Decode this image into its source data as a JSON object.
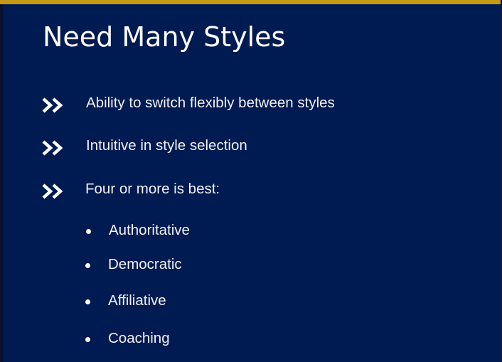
{
  "slide": {
    "title": "Need Many Styles",
    "bullets": [
      {
        "text": "Ability to switch flexibly between styles",
        "icon": "double-chevron-right-icon"
      },
      {
        "text": "Intuitive in style selection",
        "icon": "double-chevron-right-icon"
      },
      {
        "text": "Four or more is best:",
        "icon": "double-chevron-right-icon"
      }
    ],
    "sub_bullets": [
      {
        "text": "Authoritative",
        "icon": "bullet-dot-icon"
      },
      {
        "text": "Democratic",
        "icon": "bullet-dot-icon"
      },
      {
        "text": "Affiliative",
        "icon": "bullet-dot-icon"
      },
      {
        "text": "Coaching",
        "icon": "bullet-dot-icon"
      }
    ]
  },
  "colors": {
    "background": "#001a52",
    "accent_bar": "#c79a16",
    "text": "#ffffff"
  }
}
